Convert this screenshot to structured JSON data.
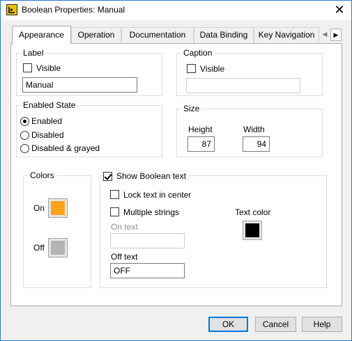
{
  "window": {
    "title": "Boolean Properties: Manual",
    "close_symbol": "✕"
  },
  "tabs": [
    {
      "label": "Appearance",
      "active": true
    },
    {
      "label": "Operation"
    },
    {
      "label": "Documentation"
    },
    {
      "label": "Data Binding"
    },
    {
      "label": "Key Navigation"
    }
  ],
  "tab_scroll": {
    "left": "◀",
    "right": "▶"
  },
  "label_group": {
    "title": "Label",
    "visible_label": "Visible",
    "visible_checked": false,
    "value": "Manual"
  },
  "caption_group": {
    "title": "Caption",
    "visible_label": "Visible",
    "visible_checked": false,
    "value": ""
  },
  "enabled_state": {
    "title": "Enabled State",
    "options": [
      "Enabled",
      "Disabled",
      "Disabled & grayed"
    ],
    "selected": "Enabled"
  },
  "size_group": {
    "title": "Size",
    "height_label": "Height",
    "height_value": "87",
    "width_label": "Width",
    "width_value": "94"
  },
  "colors_group": {
    "title": "Colors",
    "on_label": "On",
    "on_color": "#ffa31a",
    "off_label": "Off",
    "off_color": "#b3b3b3"
  },
  "boolean_text": {
    "show_label": "Show Boolean text",
    "show_checked": true,
    "lock_label": "Lock text in center",
    "lock_checked": false,
    "multiple_label": "Multiple strings",
    "multiple_checked": false,
    "on_text_label": "On text",
    "on_text_value": "",
    "off_text_label": "Off text",
    "off_text_value": "OFF",
    "text_color_label": "Text color",
    "text_color": "#000000"
  },
  "buttons": {
    "ok": "OK",
    "cancel": "Cancel",
    "help": "Help"
  }
}
